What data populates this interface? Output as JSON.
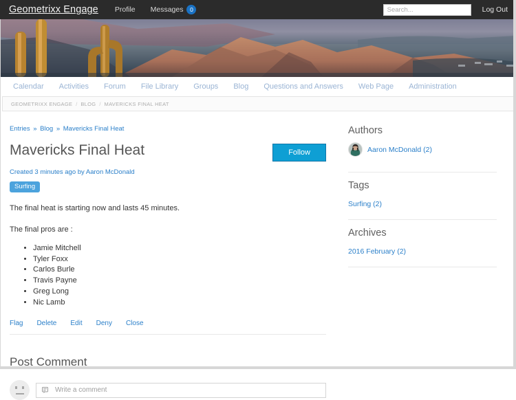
{
  "topbar": {
    "brand": "Geometrixx Engage",
    "nav": [
      {
        "label": "Profile",
        "name": "profile"
      },
      {
        "label": "Messages",
        "name": "messages",
        "badge": "0"
      }
    ],
    "search_placeholder": "Search...",
    "search_value": "",
    "logout_label": "Log Out",
    "badge_color": "#1a72c4"
  },
  "mainnav": {
    "items": [
      {
        "label": "Calendar"
      },
      {
        "label": "Activities"
      },
      {
        "label": "Forum"
      },
      {
        "label": "File Library"
      },
      {
        "label": "Groups"
      },
      {
        "label": "Blog"
      },
      {
        "label": "Questions and Answers"
      },
      {
        "label": "Web Page"
      },
      {
        "label": "Administration"
      }
    ]
  },
  "breadcrumb": {
    "items": [
      "GEOMETRIXX ENGAGE",
      "BLOG",
      "MAVERICKS FINAL HEAT"
    ],
    "separator": "/"
  },
  "entry": {
    "trail": {
      "entries": "Entries",
      "blog": "Blog",
      "current": "Mavericks Final Heat",
      "separator": "»"
    },
    "title": "Mavericks Final Heat",
    "follow_label": "Follow",
    "follow_color": "#0e9fd4",
    "meta": "Created 3 minutes ago by Aaron McDonald",
    "tag": "Surfing",
    "tag_color": "#4ca3dd",
    "paragraph1": "The final heat is starting now and lasts 45 minutes.",
    "paragraph2": "The final pros are :",
    "pros": [
      "Jamie Mitchell",
      "Tyler Foxx",
      "Carlos Burle",
      "Travis Payne",
      "Greg Long",
      "Nic Lamb"
    ],
    "actions": [
      {
        "label": "Flag"
      },
      {
        "label": "Delete"
      },
      {
        "label": "Edit"
      },
      {
        "label": "Deny"
      },
      {
        "label": "Close"
      }
    ]
  },
  "comment": {
    "heading": "Post Comment",
    "placeholder": "Write a comment",
    "value": ""
  },
  "sidebar": {
    "authors": {
      "heading": "Authors",
      "items": [
        {
          "label": "Aaron McDonald (2)"
        }
      ]
    },
    "tags": {
      "heading": "Tags",
      "items": [
        {
          "label": "Surfing (2)"
        }
      ]
    },
    "archives": {
      "heading": "Archives",
      "items": [
        {
          "label": "2016 February (2)"
        }
      ]
    }
  }
}
